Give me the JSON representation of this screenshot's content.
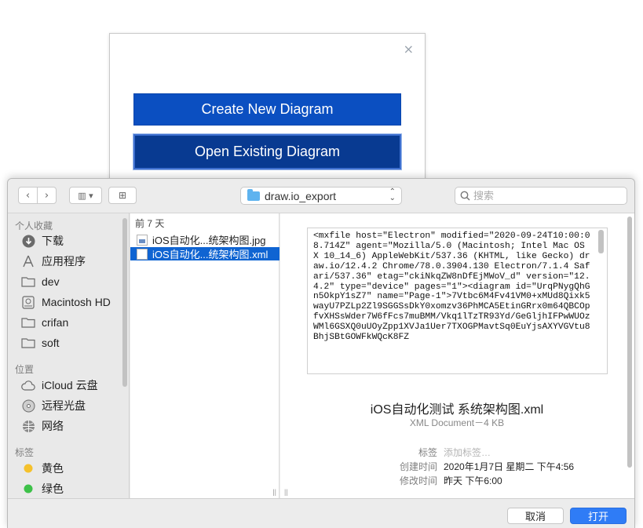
{
  "drawio": {
    "close_glyph": "×",
    "create_label": "Create New Diagram",
    "open_label": "Open Existing Diagram"
  },
  "toolbar": {
    "back_glyph": "‹",
    "forward_glyph": "›",
    "view_glyph": "▥ ▾",
    "new_folder_glyph": "⊞",
    "folder_name": "draw.io_export",
    "search_placeholder": "搜索"
  },
  "sidebar": {
    "favorites_title": "个人收藏",
    "favorites": [
      {
        "label": "下载",
        "icon": "download-icon"
      },
      {
        "label": "应用程序",
        "icon": "applications-icon"
      },
      {
        "label": "dev",
        "icon": "folder-icon"
      },
      {
        "label": "Macintosh HD",
        "icon": "disk-icon"
      },
      {
        "label": "crifan",
        "icon": "folder-icon"
      },
      {
        "label": "soft",
        "icon": "folder-icon"
      }
    ],
    "locations_title": "位置",
    "locations": [
      {
        "label": "iCloud 云盘",
        "icon": "cloud-icon"
      },
      {
        "label": "远程光盘",
        "icon": "disc-icon"
      },
      {
        "label": "网络",
        "icon": "network-icon"
      }
    ],
    "tags_title": "标签",
    "tags": [
      {
        "label": "黄色",
        "color": "#f5c12c"
      },
      {
        "label": "绿色",
        "color": "#3dc149"
      }
    ]
  },
  "files": {
    "header": "前 7 天",
    "items": [
      {
        "name": "iOS自动化...统架构图.jpg",
        "selected": false
      },
      {
        "name": "iOS自动化...统架构图.xml",
        "selected": true
      }
    ]
  },
  "preview": {
    "xml_text": "<mxfile host=\"Electron\" modified=\"2020-09-24T10:00:08.714Z\" agent=\"Mozilla/5.0 (Macintosh; Intel Mac OS X 10_14_6) AppleWebKit/537.36 (KHTML, like Gecko) draw.io/12.4.2 Chrome/78.0.3904.130 Electron/7.1.4 Safari/537.36\" etag=\"ckiNkqZW8nDfEjMWoV_d\" version=\"12.4.2\" type=\"device\" pages=\"1\"><diagram id=\"UrqPNygQhGn5OkpY1sZ7\" name=\"Page-1\">7Vtbc6M4Fv41VM0+xMUd8Qixk5wayU7PZLp2Zl9SGGSsDkY0xomzv36PhMCA5EtinGRrx0m64QBCOpfvXHSsWder7W6fFcs7muBMM/Vkq1lTzTR93Yd/GeGljhIFPwWUOzWMl6GSXQ0uUOyZpp1XVJa1Uer7TXOGPMavtSq0EuYjsAXYVGVtu8BhjSBtGOWFkWQcK8FZ",
    "file_name": "iOS自动化测试 系统架构图.xml",
    "file_kind": "XML Document－4 KB",
    "tags_label": "标签",
    "tags_placeholder": "添加标签…",
    "created_label": "创建时间",
    "created_value": "2020年1月7日 星期二 下午4:56",
    "modified_label": "修改时间",
    "modified_value": "昨天 下午6:00"
  },
  "buttons": {
    "cancel": "取消",
    "open": "打开"
  }
}
